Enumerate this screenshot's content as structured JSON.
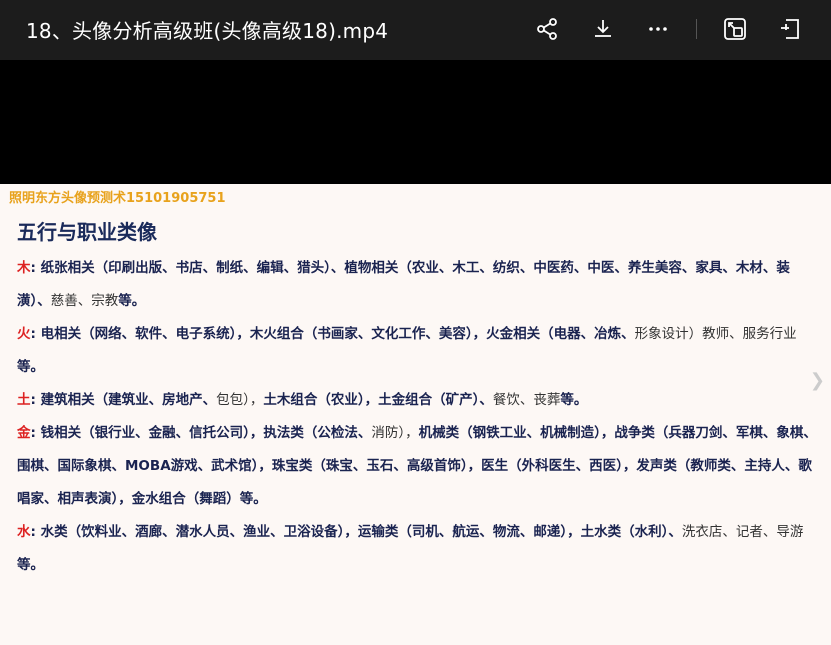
{
  "window": {
    "title": "18、头像分析高级班(头像高级18).mp4",
    "icons": [
      "share-icon",
      "download-icon",
      "more-icon",
      "picture-in-picture-icon",
      "fullscreen-exit-icon"
    ]
  },
  "slide": {
    "watermark": "照明东方头像预测术15101905751",
    "heading": "五行与职业类像",
    "sections": [
      {
        "element": "木",
        "colon": ":",
        "bold_text": "纸张相关（印刷出版、书店、制纸、编辑、猎头）、植物相关（农业、木工、纺织、中医药、中医、养生美容、家具、木材、装潢）、",
        "plain_text": "慈善、宗教",
        "end": "等。"
      },
      {
        "element": "火",
        "colon": ":",
        "bold_text": "电相关（网络、软件、电子系统），木火组合（书画家、文化工作、美容），火金相关（电器、冶炼、",
        "plain_text": "形象设计）教师、服务行业",
        "end": "等。"
      },
      {
        "element": "土",
        "colon": ":",
        "bold_text": "建筑相关（建筑业、房地产、",
        "plain_text": "包包），",
        "bold_text_2": "土木组合（农业），土金组合（矿产）、",
        "plain_text_2": "餐饮、丧葬",
        "end": "等。"
      },
      {
        "element": "金",
        "colon": ":",
        "bold_text": "钱相关（银行业、金融、信托公司），执法类（公检法、",
        "plain_text": "消防），",
        "bold_text_2": "机械类（钢铁工业、机械制造），战争类（兵器刀剑、军棋、象棋、围棋、国际象棋、MOBA游戏、武术馆），珠宝类（珠宝、玉石、高级首饰），医生（外科医生、西医），发声类（教师类、主持人、歌唱家、相声表演），金水组合（舞蹈）",
        "plain_text_2": "",
        "end": "等。"
      },
      {
        "element": "水",
        "colon": ":",
        "bold_text": "水类（饮料业、酒廊、潜水人员、渔业、卫浴设备），运输类（司机、航运、物流、邮递），土水类（水利）、",
        "plain_text": "洗衣店、记者、导游",
        "end": "等。"
      }
    ]
  }
}
